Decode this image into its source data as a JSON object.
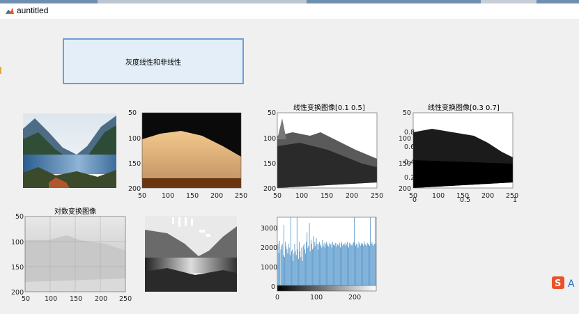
{
  "window": {
    "title": "auntitled"
  },
  "button": {
    "label": "灰度线性和非线性"
  },
  "axes": {
    "linear1": {
      "title": "线性变换图像[0.1 0.5]",
      "xticks": [
        "50",
        "100",
        "150",
        "200",
        "250"
      ],
      "yticks": [
        "50",
        "100",
        "150",
        "200"
      ]
    },
    "linear2": {
      "title": "线性变换图像[0.3 0.7]",
      "xticks": [
        "50",
        "100",
        "150",
        "200",
        "250"
      ],
      "yticks": [
        "50",
        "100",
        "150",
        "200"
      ],
      "overlay_x": [
        "0",
        "0.5",
        "1"
      ],
      "overlay_y": [
        "0.8",
        "0.6",
        "0.4",
        "0.2"
      ]
    },
    "original_color": {
      "xticks": [
        "50",
        "100",
        "150",
        "200",
        "250"
      ],
      "yticks": [
        "50",
        "100",
        "150",
        "200"
      ]
    },
    "log": {
      "title": "对数变换图像",
      "xticks": [
        "50",
        "100",
        "150",
        "200",
        "250"
      ],
      "yticks": [
        "50",
        "100",
        "150",
        "200"
      ]
    },
    "histogram": {
      "xticks": [
        "0",
        "100",
        "200"
      ],
      "yticks": [
        "0",
        "1000",
        "2000",
        "3000"
      ]
    }
  },
  "chart_data": {
    "type": "bar",
    "title": "",
    "xlabel": "",
    "ylabel": "",
    "xlim": [
      0,
      256
    ],
    "ylim": [
      0,
      3600
    ],
    "x": [
      2,
      4,
      6,
      9,
      11,
      13,
      15,
      17,
      19,
      21,
      23,
      25,
      27,
      29,
      31,
      33,
      35,
      37,
      39,
      41,
      43,
      45,
      47,
      49,
      51,
      53,
      55,
      57,
      59,
      61,
      63,
      65,
      67,
      69,
      71,
      73,
      75,
      77,
      79,
      81,
      83,
      85,
      87,
      89,
      91,
      93,
      95,
      97,
      99,
      101,
      103,
      105,
      107,
      109,
      111,
      113,
      115,
      117,
      119,
      121,
      123,
      125,
      127,
      129,
      131,
      133,
      135,
      137,
      139,
      141,
      143,
      145,
      147,
      149,
      151,
      153,
      155,
      157,
      159,
      161,
      163,
      165,
      167,
      169,
      171,
      173,
      175,
      177,
      179,
      181,
      183,
      185,
      187,
      189,
      191,
      193,
      195,
      197,
      199,
      201,
      203,
      205,
      207,
      209,
      211,
      213,
      215,
      217,
      219,
      221,
      223,
      225,
      227,
      229,
      231,
      233,
      235,
      237,
      239,
      241,
      243,
      245,
      247,
      249,
      251,
      253,
      255
    ],
    "values": [
      2200,
      1700,
      2350,
      1900,
      2100,
      2200,
      1600,
      3200,
      1500,
      2300,
      2050,
      1900,
      1700,
      2200,
      2000,
      1600,
      3650,
      1800,
      1900,
      1300,
      1700,
      2200,
      1800,
      1600,
      3600,
      1900,
      1400,
      2300,
      1800,
      1500,
      2000,
      1300,
      2100,
      2200,
      1900,
      1700,
      2300,
      2800,
      2000,
      2100,
      3300,
      1800,
      2400,
      2200,
      1900,
      2600,
      2000,
      2300,
      2100,
      2500,
      2200,
      1900,
      2200,
      2300,
      2100,
      2200,
      2000,
      2400,
      2100,
      2250,
      2000,
      2200,
      2300,
      2100,
      2200,
      2050,
      2250,
      2150,
      2200,
      2000,
      2300,
      2150,
      2200,
      2100,
      2250,
      2050,
      2200,
      2150,
      2100,
      2250,
      2000,
      2200,
      2300,
      2100,
      2200,
      2150,
      2250,
      2100,
      2200,
      2300,
      2100,
      2000,
      2250,
      2200,
      2150,
      2100,
      2200,
      2300,
      3600,
      2250,
      2100,
      2200,
      2150,
      2000,
      2300,
      2200,
      2100,
      2250,
      2150,
      2200,
      2100,
      2300,
      2200,
      2150,
      2100,
      2250,
      2200,
      2150,
      2100,
      3600,
      2200,
      2300,
      2150,
      2100,
      2200,
      3600,
      2200
    ]
  },
  "colors": {
    "bar": "#4a90c8",
    "button_bg": "#e3eef8",
    "button_border": "#6f9fce",
    "grid": "#dddddd"
  },
  "icons": {
    "window_icon": "matlab-icon",
    "ime_icon": "sogou-ime-icon"
  },
  "ime": {
    "label": "A"
  }
}
